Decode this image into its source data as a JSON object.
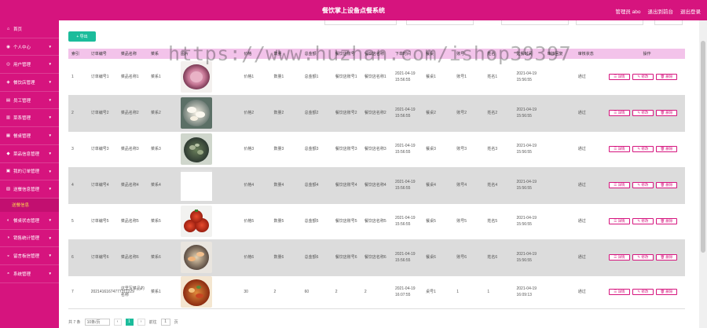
{
  "header": {
    "title": "餐饮掌上设备点餐系统",
    "admin_label": "管理员 abo",
    "backend_label": "退出到前台",
    "logout_label": "退出登录"
  },
  "sidebar": {
    "items": [
      {
        "icon": "home-icon",
        "glyph": "⌂",
        "label": "首页",
        "has_chevron": false
      },
      {
        "icon": "person-icon",
        "glyph": "◉",
        "label": "个人中心",
        "has_chevron": true
      },
      {
        "icon": "users-icon",
        "glyph": "◎",
        "label": "用户管理",
        "has_chevron": true
      },
      {
        "icon": "shop-icon",
        "glyph": "◈",
        "label": "餐饮店管理",
        "has_chevron": true
      },
      {
        "icon": "staff-icon",
        "glyph": "▤",
        "label": "员工管理",
        "has_chevron": true
      },
      {
        "icon": "dish-icon",
        "glyph": "▥",
        "label": "菜系管理",
        "has_chevron": true
      },
      {
        "icon": "table-icon",
        "glyph": "▦",
        "label": "餐桌管理",
        "has_chevron": true
      },
      {
        "icon": "product-icon",
        "glyph": "◆",
        "label": "菜品信息管理",
        "has_chevron": true
      },
      {
        "icon": "order-icon",
        "glyph": "▣",
        "label": "我的订单管理",
        "has_chevron": true
      },
      {
        "icon": "menu-icon",
        "glyph": "▧",
        "label": "送餐信息管理",
        "has_chevron": true
      }
    ],
    "active_sub": "送餐信息",
    "items_after": [
      {
        "icon": "eval-icon",
        "glyph": "◐",
        "label": "餐桌状态管理",
        "has_chevron": true
      },
      {
        "icon": "stats-icon",
        "glyph": "◑",
        "label": "销售统计管理",
        "has_chevron": true
      },
      {
        "icon": "news-icon",
        "glyph": "◒",
        "label": "留言板信管理",
        "has_chevron": true
      },
      {
        "icon": "system-icon",
        "glyph": "◓",
        "label": "系统管理",
        "has_chevron": true
      }
    ]
  },
  "toolbar": {
    "export_label": "+ 导出"
  },
  "table": {
    "headers": [
      "索引",
      "订单编号",
      "菜品名称",
      "菜系",
      "图片",
      "价格",
      "数量",
      "总金额",
      "餐饮店账号",
      "餐饮店名称",
      "下单时间",
      "餐桌",
      "账号",
      "姓名",
      "送餐时间",
      "审核回复",
      "审核状态",
      "操作"
    ],
    "rows": [
      {
        "idx": "1",
        "order_no": "订单编号1",
        "name": "菜品名称1",
        "cuisine": "菜系1",
        "img": "ham",
        "price": "价格1",
        "qty": "数量1",
        "total": "总金额1",
        "shop_acc": "餐饮店账号1",
        "shop_name": "餐饮店名称1",
        "order_time": "2021-04-19 15:56:55",
        "table": "餐桌1",
        "account": "账号1",
        "real_name": "姓名1",
        "deliver_time": "2021-04-19 15:56:55",
        "reply": "",
        "status": "通过"
      },
      {
        "idx": "2",
        "order_no": "订单编号2",
        "name": "菜品名称2",
        "cuisine": "菜系2",
        "img": "dumpling",
        "price": "价格2",
        "qty": "数量2",
        "total": "总金额2",
        "shop_acc": "餐饮店账号2",
        "shop_name": "餐饮店名称2",
        "order_time": "2021-04-19 15:56:55",
        "table": "餐桌2",
        "account": "账号2",
        "real_name": "姓名2",
        "deliver_time": "2021-04-19 15:56:55",
        "reply": "",
        "status": "通过"
      },
      {
        "idx": "3",
        "order_no": "订单编号3",
        "name": "菜品名称3",
        "cuisine": "菜系3",
        "img": "clams",
        "price": "价格3",
        "qty": "数量3",
        "total": "总金额3",
        "shop_acc": "餐饮店账号3",
        "shop_name": "餐饮店名称3",
        "order_time": "2021-04-19 15:56:55",
        "table": "餐桌3",
        "account": "账号3",
        "real_name": "姓名3",
        "deliver_time": "2021-04-19 15:56:55",
        "reply": "",
        "status": "通过"
      },
      {
        "idx": "4",
        "order_no": "订单编号4",
        "name": "菜品名称4",
        "cuisine": "菜系4",
        "img": "blank",
        "price": "价格4",
        "qty": "数量4",
        "total": "总金额4",
        "shop_acc": "餐饮店账号4",
        "shop_name": "餐饮店名称4",
        "order_time": "2021-04-19 15:56:55",
        "table": "餐桌4",
        "account": "账号4",
        "real_name": "姓名4",
        "deliver_time": "2021-04-19 15:56:55",
        "reply": "",
        "status": "通过"
      },
      {
        "idx": "5",
        "order_no": "订单编号5",
        "name": "菜品名称5",
        "cuisine": "菜系5",
        "img": "tomato",
        "price": "价格5",
        "qty": "数量5",
        "total": "总金额5",
        "shop_acc": "餐饮店账号5",
        "shop_name": "餐饮店名称5",
        "order_time": "2021-04-19 15:56:55",
        "table": "餐桌5",
        "account": "账号5",
        "real_name": "姓名5",
        "deliver_time": "2021-04-19 15:56:55",
        "reply": "",
        "status": "通过"
      },
      {
        "idx": "6",
        "order_no": "订单编号6",
        "name": "菜品名称6",
        "cuisine": "菜系6",
        "img": "shrimp",
        "price": "价格6",
        "qty": "数量6",
        "total": "总金额6",
        "shop_acc": "餐饮店账号6",
        "shop_name": "餐饮店名称6",
        "order_time": "2021-04-19 15:56:55",
        "table": "餐桌6",
        "account": "账号6",
        "real_name": "姓名6",
        "deliver_time": "2021-04-19 15:56:55",
        "reply": "",
        "status": "通过"
      },
      {
        "idx": "7",
        "order_no": "20214161674777311229",
        "name": "这里写菜品的名称",
        "cuisine": "菜系1",
        "img": "hotpot",
        "price": "30",
        "qty": "2",
        "total": "60",
        "shop_acc": "2",
        "shop_name": "2",
        "order_time": "2021-04-19 16:07:55",
        "table": "桌号1",
        "account": "1",
        "real_name": "1",
        "deliver_time": "2021-04-19 16:09:13",
        "reply": "",
        "status": "通过"
      }
    ],
    "op_view": "☰ 详情",
    "op_edit": "✎ 修改",
    "op_delete": "🗑 删除"
  },
  "pager": {
    "total": "共 7 条",
    "page_size": "10条/页",
    "prev": "‹",
    "current": "1",
    "next": "›",
    "goto_label": "前往",
    "goto_value": "1",
    "page_unit": "页"
  },
  "watermark": "https://www.huzhan.com/ishop39397",
  "colors": {
    "primary": "#d6147e",
    "accent": "#1bbc9b",
    "header_row": "#f3c3ea",
    "alt_row": "#dcdcdc"
  }
}
